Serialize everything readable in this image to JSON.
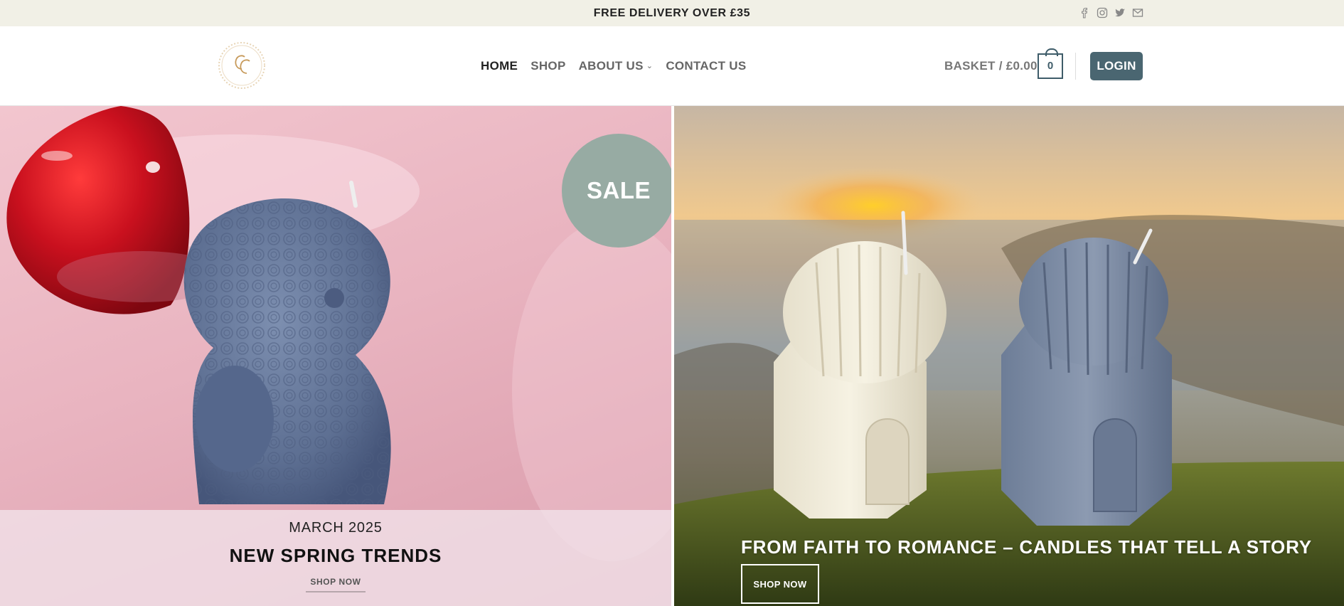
{
  "topbar": {
    "promo": "FREE DELIVERY OVER £35",
    "social": [
      "facebook-icon",
      "instagram-icon",
      "twitter-icon",
      "email-icon"
    ]
  },
  "header": {
    "logo_text": "CC",
    "nav": [
      {
        "label": "HOME",
        "active": true
      },
      {
        "label": "SHOP",
        "active": false
      },
      {
        "label": "ABOUT US",
        "active": false,
        "has_dropdown": true
      },
      {
        "label": "CONTACT US",
        "active": false
      }
    ],
    "basket_label": "BASKET / £0.00",
    "basket_count": "0",
    "login_label": "LOGIN"
  },
  "hero": {
    "left": {
      "sale_badge": "SALE",
      "date": "MARCH 2025",
      "title": "NEW SPRING TRENDS",
      "link": "SHOP NOW"
    },
    "right": {
      "title": "FROM FAITH TO ROMANCE – CANDLES THAT TELL A STORY",
      "button": "SHOP NOW"
    }
  },
  "colors": {
    "topbar_bg": "#f1f0e6",
    "accent": "#4a6671",
    "sale_badge": "#97aba3"
  }
}
